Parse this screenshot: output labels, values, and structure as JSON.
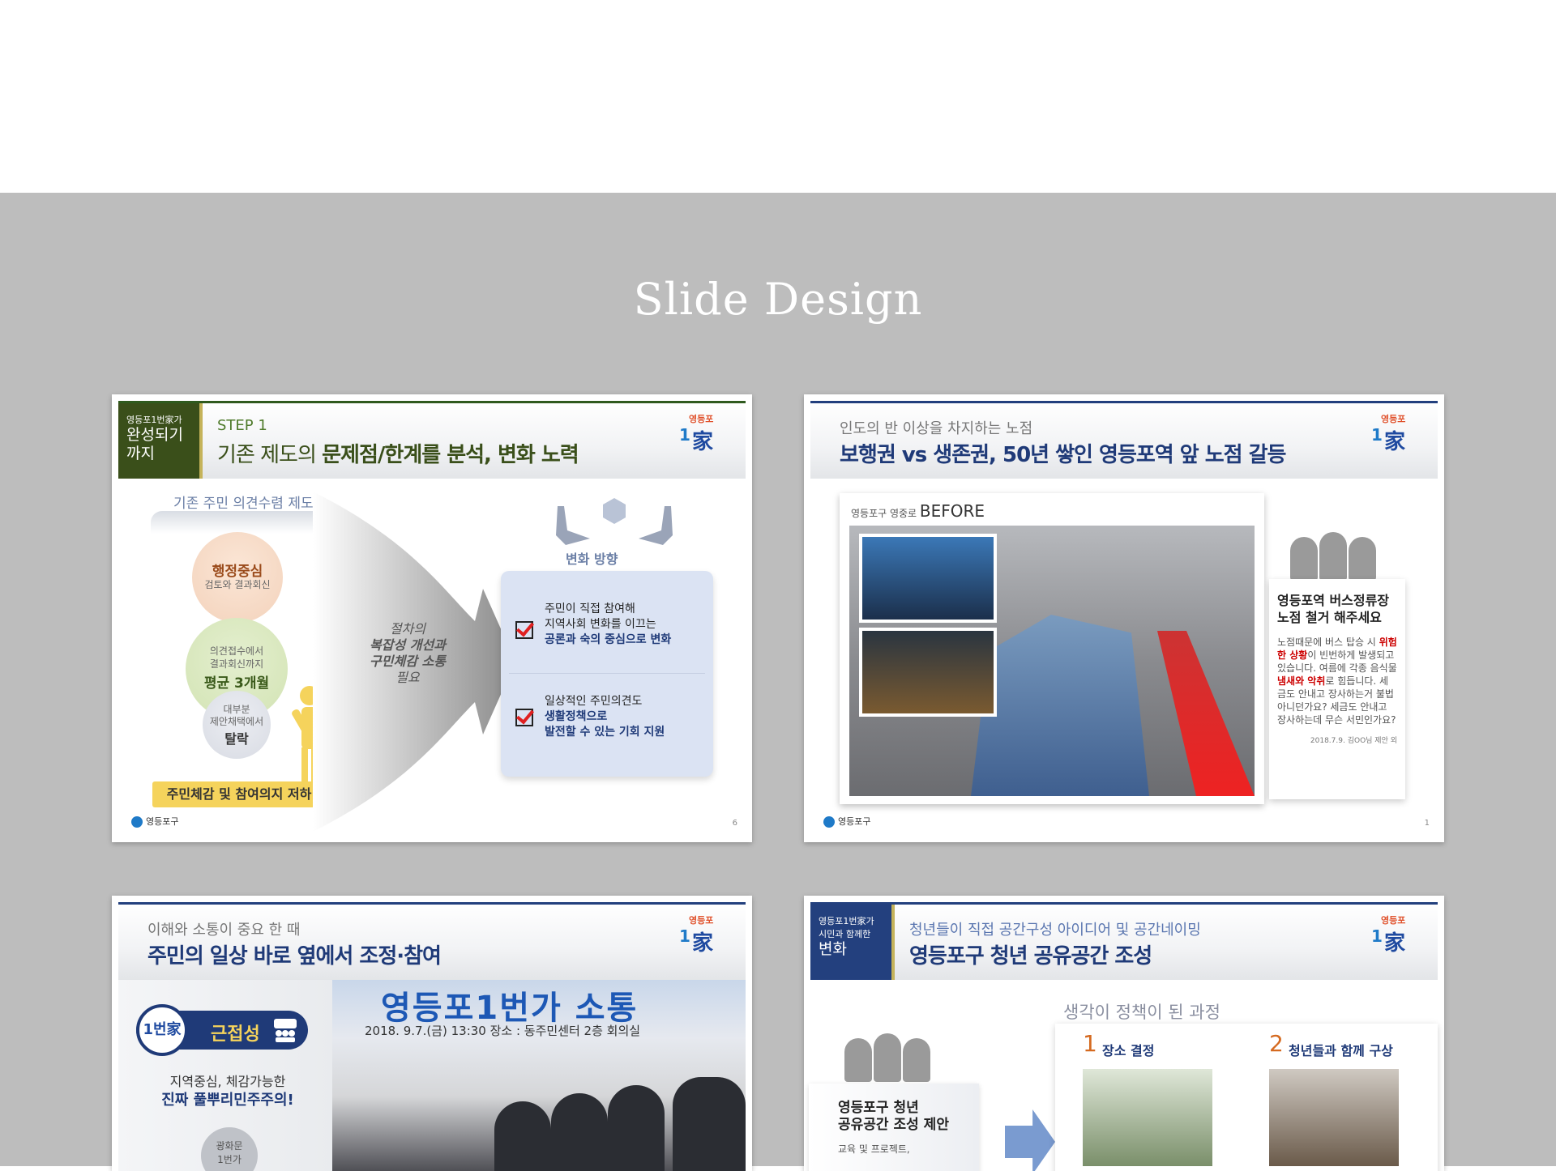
{
  "page": {
    "title": "Slide Design"
  },
  "slides": [
    {
      "badge_small": "영등포1번家가",
      "badge_big_1": "완성되기",
      "badge_big_2": "까지",
      "sub": "STEP 1",
      "main_1": "기존 제도의 ",
      "main_2": "문제점/한계를 분석, 변화 노력",
      "left_title": "기존 주민 의견수렴 제도",
      "circle1_title": "행정중심",
      "circle1_sub": "검토와 결과회신",
      "circle2_sub_1": "의견접수에서",
      "circle2_sub_2": "결과회신까지",
      "circle2_title": "평균 3개월",
      "circle3_sub_1": "대부분",
      "circle3_sub_2": "제안채택에서",
      "circle3_title": "탈락",
      "bottom_bar": "주민체감 및 참여의지 저하",
      "funnel_1": "절차의",
      "funnel_2": "복잡성 개선과",
      "funnel_3": "구민체감 소통",
      "funnel_4": "필요",
      "right_head": "변화 방향",
      "item1_1": "주민이 직접 참여해",
      "item1_2": "지역사회 변화를 이끄는",
      "item1_hl": "공론과 숙의 중심으로 변화",
      "item2_1": "일상적인 주민의견도",
      "item2_hl_1": "생활정책으로",
      "item2_hl_2": "발전할 수 있는 기회 지원",
      "footer": "영등포구",
      "page": "6"
    },
    {
      "sub": "인도의 반 이상을 차지하는 노점",
      "main": "보행권 vs 생존권, 50년 쌓인 영등포역 앞 노점 갈등",
      "photo_cap_small": "영등포구 영중로 ",
      "photo_cap_big": "BEFORE",
      "note_title_1": "영등포역 버스정류장",
      "note_title_2": "노점 철거 해주세요",
      "note_1": "노점때문에 버스 탑승 시",
      "note_red_1": "위험한 상황",
      "note_2": "이 빈번하게 발생되고 있습니다. 여름에 각종 음식물 ",
      "note_red_2": "냄새와 악취",
      "note_3": "로 힘듭니다. 세금도 안내고 장사하는거 불법 아니던가요? 세금도 안내고 장사하는데 무슨 서민인가요?",
      "note_sig": "2018.7.9. 김OO님 제안 외",
      "footer": "영등포구",
      "page": "1"
    },
    {
      "sub": "이해와 소통이 중요 한 때",
      "main": "주민의 일상 바로 옆에서 조정·참여",
      "pill_logo": "1번家",
      "pill_text": "근접성",
      "text1": "지역중심, 체감가능한",
      "text2": "진짜 풀뿌리민주주의!",
      "circle_1": "광화문",
      "circle_2": "1번가",
      "banner": "영등포1번가 소통",
      "banner_sub": "2018. 9.7.(금) 13:30   장소 : 동주민센터 2층 회의실"
    },
    {
      "badge_small_1": "영등포1번家가",
      "badge_small_2": "시민과 함께한",
      "badge_big": "변화",
      "sub": "청년들이 직접 공간구성 아이디어 및 공간네이밍",
      "main": "영등포구 청년 공유공간 조성",
      "process": "생각이 정책이 된 과정",
      "step1_num": "1",
      "step1_label": "장소 결정",
      "step2_num": "2",
      "step2_label": "청년들과 함께 구상",
      "card_title_1": "영등포구 청년",
      "card_title_2": "공유공간 조성 제안",
      "card_body": "교육 및 프로젝트,"
    }
  ],
  "logo": {
    "top": "영등포",
    "num": "1",
    "char": "家"
  },
  "colors": {
    "navy": "#1f3a78",
    "green": "#3a4f1a",
    "gold": "#c5b35a",
    "gray_bg": "#bdbdbd"
  }
}
